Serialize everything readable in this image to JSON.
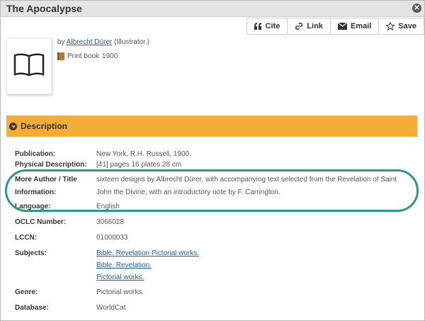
{
  "window": {
    "title": "The Apocalypse"
  },
  "toolbar": {
    "cite": "Cite",
    "link": "Link",
    "email": "Email",
    "save": "Save"
  },
  "record": {
    "by_prefix": "by",
    "author": "Albrecht Dürer",
    "author_role": "(Illustrator.)",
    "format": "Print book",
    "year": "1900"
  },
  "description": {
    "header": "Description",
    "rows": [
      {
        "key": "Publication:",
        "value": "New York, R.H. Russell, 1900."
      },
      {
        "key": "Physical Description:",
        "value": "[41] pages 16 plates 28 cm"
      },
      {
        "key": "More Author / Title Information:",
        "value": "sixteen designs by Albrecht Dürer, with accompanying text selected from the Revelation of Saint John the Divine, with an introductory note by F. Carrington."
      },
      {
        "key": "Language:",
        "value": "English"
      },
      {
        "key": "OCLC Number:",
        "value": "3066028"
      },
      {
        "key": "LCCN:",
        "value": "01000033"
      },
      {
        "key": "Subjects:",
        "links": [
          "Bible. Revelation Pictorial works.",
          "Bible. Revelation.",
          "Pictorial works."
        ]
      },
      {
        "key": "Genre:",
        "value": "Pictorial works."
      },
      {
        "key": "Database:",
        "value": "WorldCat"
      }
    ]
  },
  "colors": {
    "accent": "#f5ad37",
    "highlight": "#2a9a82",
    "link": "#1f5d9c"
  }
}
